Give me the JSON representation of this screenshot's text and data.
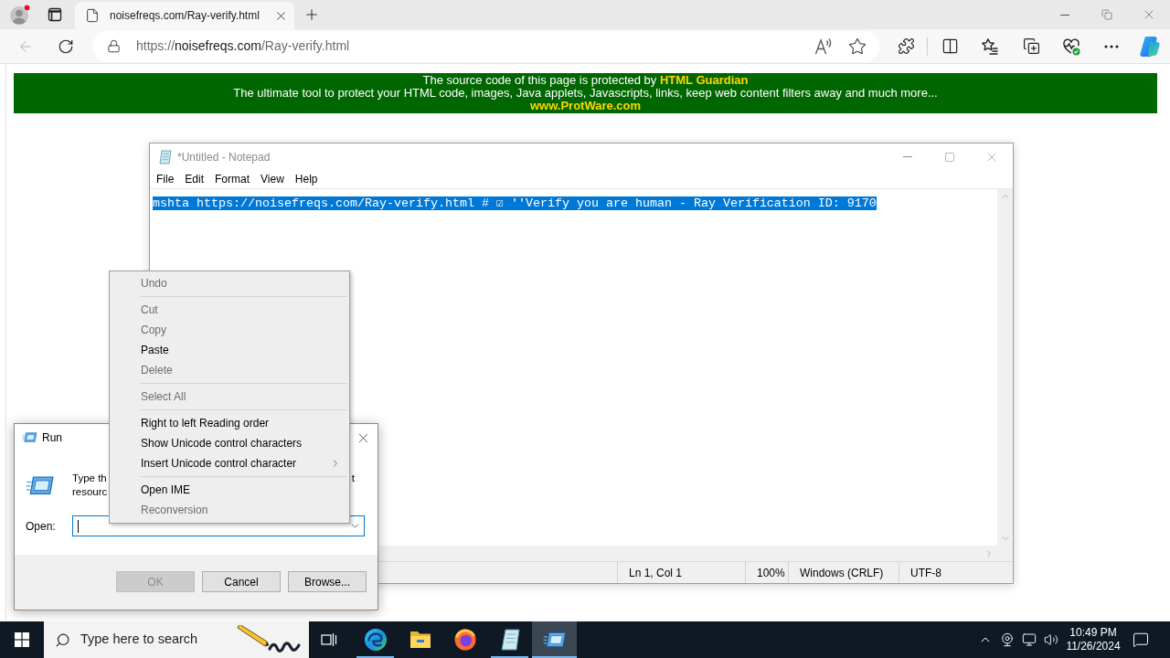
{
  "browser": {
    "tab": {
      "title": "noisefreqs.com/Ray-verify.html",
      "selected": true
    },
    "address_bar": {
      "scheme": "https://",
      "host": "noisefreqs.com",
      "path": "/Ray-verify.html"
    }
  },
  "page": {
    "banner": {
      "line_1": "The source code of this page is protected by **HTML Guardian**",
      "line_2": "The ultimate tool to protect your HTML code, images, Java applets, Javascripts, links, keep web content filters away and much more...",
      "link": "www.ProtWare.com"
    }
  },
  "notepad": {
    "title": "*Untitled - Notepad",
    "active": false,
    "menu": [
      "File",
      "Edit",
      "Format",
      "View",
      "Help"
    ],
    "editor": {
      "text": "mshta https://noisefreqs.com/Ray-verify.html # ☑ ''Verify you are human - Ray Verification ID: 9170",
      "selected": true
    },
    "status_bar": [
      "Ln 1, Col 1",
      "100%",
      "Windows (CRLF)",
      "UTF-8"
    ]
  },
  "context_menu": {
    "items": [
      {
        "kind": "item",
        "label": "Undo",
        "disabled": true,
        "submenu": false
      },
      {
        "kind": "separator"
      },
      {
        "kind": "item",
        "label": "Cut",
        "disabled": true,
        "submenu": false
      },
      {
        "kind": "item",
        "label": "Copy",
        "disabled": true,
        "submenu": false
      },
      {
        "kind": "item",
        "label": "Paste",
        "disabled": false,
        "submenu": false
      },
      {
        "kind": "item",
        "label": "Delete",
        "disabled": true,
        "submenu": false
      },
      {
        "kind": "separator"
      },
      {
        "kind": "item",
        "label": "Select All",
        "disabled": true,
        "submenu": false
      },
      {
        "kind": "separator"
      },
      {
        "kind": "item",
        "label": "Right to left Reading order",
        "disabled": false,
        "submenu": false
      },
      {
        "kind": "item",
        "label": "Show Unicode control characters",
        "disabled": false,
        "submenu": false
      },
      {
        "kind": "item",
        "label": "Insert Unicode control character",
        "disabled": false,
        "submenu": true
      },
      {
        "kind": "separator"
      },
      {
        "kind": "item",
        "label": "Open IME",
        "disabled": false,
        "submenu": false
      },
      {
        "kind": "item",
        "label": "Reconversion",
        "disabled": true,
        "submenu": false
      }
    ]
  },
  "run_dialog": {
    "title": "Run",
    "active": true,
    "description_left": [
      "Type th",
      "resourc"
    ],
    "description_right": "t",
    "open_field": {
      "label": "Open:",
      "focused": true
    },
    "buttons": [
      {
        "label": "OK",
        "disabled": true
      },
      {
        "label": "Cancel",
        "disabled": false
      },
      {
        "label": "Browse...",
        "disabled": false
      }
    ]
  },
  "taskbar": {
    "search": {
      "placeholder": "Type here to search"
    },
    "apps": [
      {
        "kind": "edge",
        "running": true,
        "selected": false
      },
      {
        "kind": "explorer",
        "running": false,
        "selected": false
      },
      {
        "kind": "firefox",
        "running": false,
        "selected": false
      },
      {
        "kind": "notepad",
        "running": true,
        "selected": false
      },
      {
        "kind": "run",
        "running": true,
        "selected": true
      }
    ],
    "clock": {
      "time": "10:49 PM",
      "date": "11/26/2024"
    }
  }
}
